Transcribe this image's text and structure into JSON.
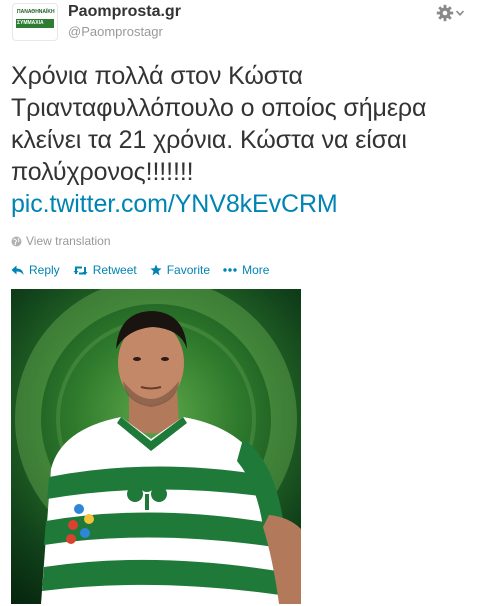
{
  "header": {
    "full_name": "Paomprosta.gr",
    "username": "@Paomprostagr",
    "avatar_text_top": "ΠΑΝΑΘΗΝΑΪΚΗ",
    "avatar_text_bottom": "ΣΥΜΜΑΧΙΑ"
  },
  "tweet": {
    "text": "Χρόνια πολλά στον Κώστα Τριανταφυλλόπουλο ο οποίος σήμερα κλείνει τα 21 χρόνια. Κώστα να είσαι πολύχρονος!!!!!!!",
    "link": "pic.twitter.com/YNV8kEvCRM"
  },
  "translation": {
    "label": "View translation"
  },
  "actions": {
    "reply": "Reply",
    "retweet": "Retweet",
    "favorite": "Favorite",
    "more": "More"
  },
  "colors": {
    "link": "#0084b4",
    "text": "#333333",
    "muted": "#999999",
    "jersey_green": "#1f7a3a"
  },
  "icons": [
    "gear-icon",
    "chevron-down-icon",
    "globe-icon",
    "reply-icon",
    "retweet-icon",
    "star-icon",
    "more-icon"
  ]
}
